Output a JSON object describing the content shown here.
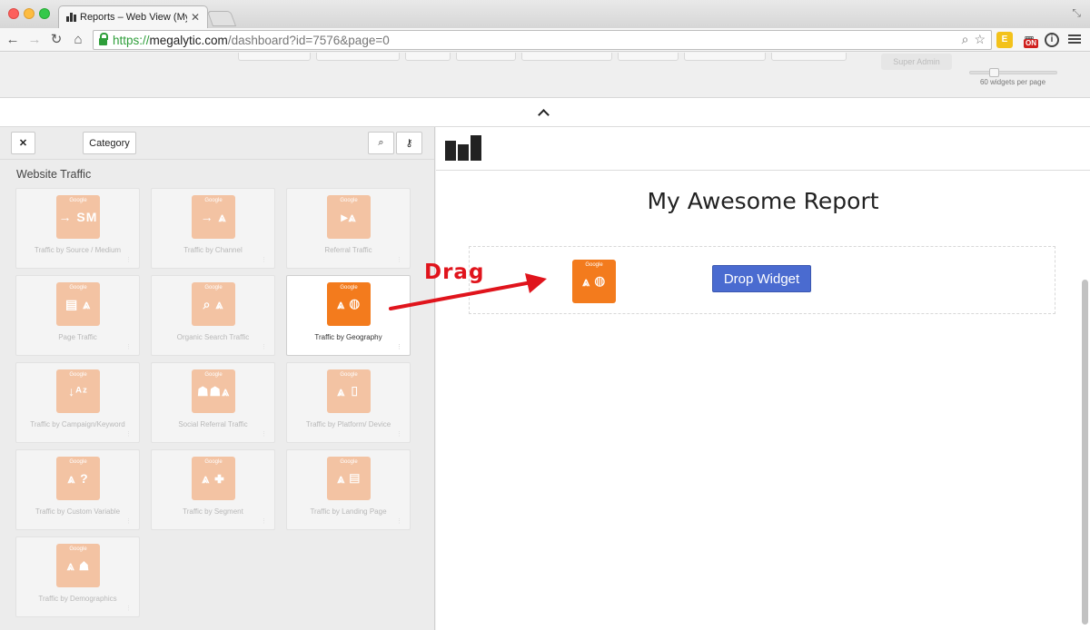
{
  "browser": {
    "tab_title": "Reports – Web View (My Av",
    "tab_close": "✕",
    "url_scheme": "https://",
    "url_host": "megalytic.com",
    "url_path": "/dashboard?id=7576&page=0",
    "ext_badge": "ON",
    "ext_key": "E",
    "ext_info": "i"
  },
  "header": {
    "super_admin": "Super Admin",
    "widgets_per_page": "60 widgets per page",
    "widgets_per_page_value": 60
  },
  "left_panel": {
    "close_label": "✕",
    "category_label": "Category",
    "section_title": "Website Traffic",
    "widgets": [
      {
        "brand": "Google",
        "glyph": "→ SM",
        "label": "Traffic by Source / Medium",
        "active": false
      },
      {
        "brand": "Google",
        "glyph": "→ ⩓",
        "label": "Traffic by Channel",
        "active": false
      },
      {
        "brand": "Google",
        "glyph": "▸⩓",
        "label": "Referral Traffic",
        "active": false
      },
      {
        "brand": "Google",
        "glyph": "▤ ⩓",
        "label": "Page Traffic",
        "active": false
      },
      {
        "brand": "Google",
        "glyph": "⌕ ⩓",
        "label": "Organic Search Traffic",
        "active": false
      },
      {
        "brand": "Google",
        "glyph": "⩓ ◍",
        "label": "Traffic by Geography",
        "active": true
      },
      {
        "brand": "Google",
        "glyph": "↓ᴬᶻ",
        "label": "Traffic by Campaign/Keyword",
        "active": false
      },
      {
        "brand": "Google",
        "glyph": "☗☗⩓",
        "label": "Social Referral Traffic",
        "active": false
      },
      {
        "brand": "Google",
        "glyph": "⩓ ▯",
        "label": "Traffic by Platform/ Device",
        "active": false
      },
      {
        "brand": "Google",
        "glyph": "⩓ ?",
        "label": "Traffic by Custom Variable",
        "active": false
      },
      {
        "brand": "Google",
        "glyph": "⩓ ✚",
        "label": "Traffic by Segment",
        "active": false
      },
      {
        "brand": "Google",
        "glyph": "⩓ ▤",
        "label": "Traffic by Landing Page",
        "active": false
      },
      {
        "brand": "Google",
        "glyph": "⩓ ☗",
        "label": "Traffic by Demographics",
        "active": false
      }
    ]
  },
  "report": {
    "title": "My Awesome Report",
    "drag_icon_brand": "Google",
    "drag_icon_glyph": "⩓ ◍",
    "drop_button": "Drop Widget"
  },
  "annotation": {
    "text": "Drag",
    "color": "#e0141c"
  },
  "colors": {
    "accent_orange": "#f37b1d",
    "faded_orange": "#f3c3a3",
    "drop_blue": "#4a6bd0"
  }
}
